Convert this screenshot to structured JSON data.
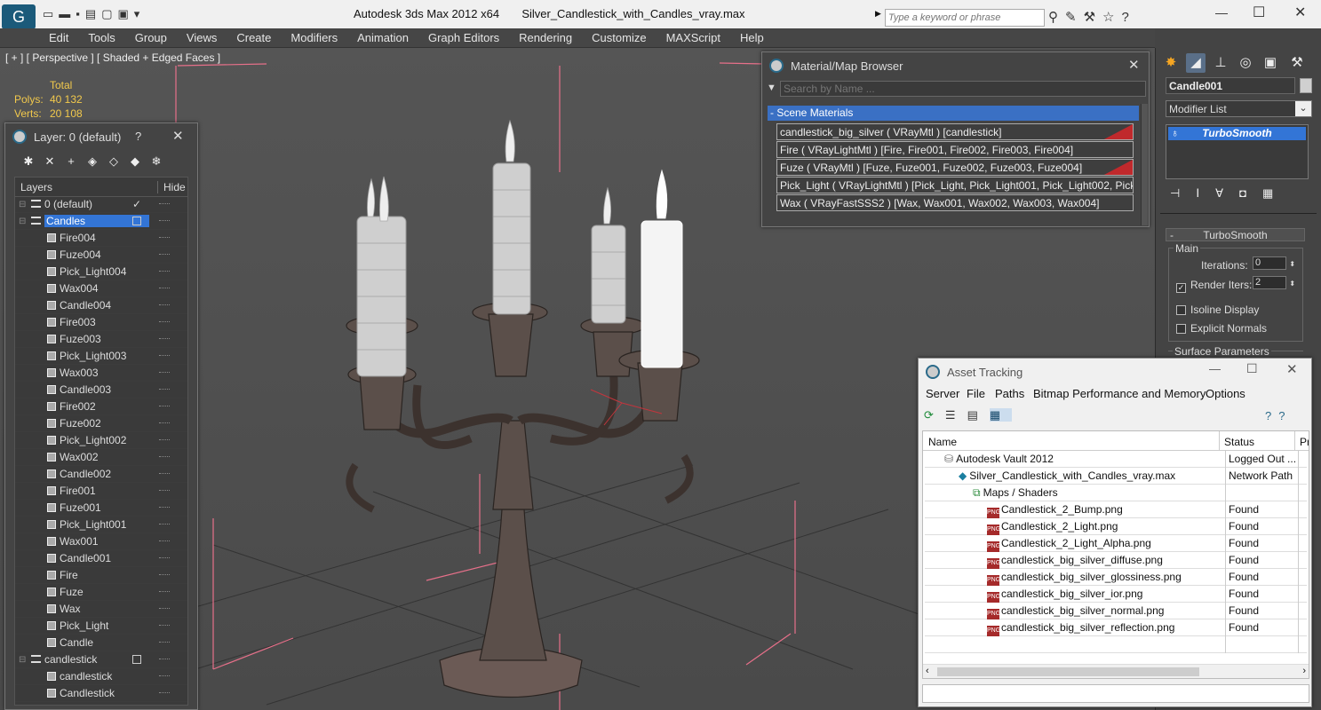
{
  "app": {
    "title": "Autodesk 3ds Max  2012 x64",
    "file": "Silver_Candlestick_with_Candles_vray.max",
    "search_placeholder": "Type a keyword or phrase"
  },
  "menu": [
    "Edit",
    "Tools",
    "Group",
    "Views",
    "Create",
    "Modifiers",
    "Animation",
    "Graph Editors",
    "Rendering",
    "Customize",
    "MAXScript",
    "Help"
  ],
  "viewport": {
    "label": "[ + ] [ Perspective ] [ Shaded + Edged Faces ]",
    "stats_header": "Total",
    "polys_label": "Polys:",
    "polys_value": "40 132",
    "verts_label": "Verts:",
    "verts_value": "20 108"
  },
  "layer_window": {
    "title": "Layer: 0 (default)",
    "help": "?",
    "col_layers": "Layers",
    "col_hide": "Hide",
    "rows": [
      {
        "label": "0 (default)",
        "type": "layer",
        "indent": 0,
        "selected": false
      },
      {
        "label": "Candles",
        "type": "layer",
        "indent": 0,
        "selected": true
      },
      {
        "label": "Fire004",
        "type": "obj",
        "indent": 1,
        "selected": false
      },
      {
        "label": "Fuze004",
        "type": "obj",
        "indent": 1,
        "selected": false
      },
      {
        "label": "Pick_Light004",
        "type": "obj",
        "indent": 1,
        "selected": false
      },
      {
        "label": "Wax004",
        "type": "obj",
        "indent": 1,
        "selected": false
      },
      {
        "label": "Candle004",
        "type": "obj",
        "indent": 1,
        "selected": false
      },
      {
        "label": "Fire003",
        "type": "obj",
        "indent": 1,
        "selected": false
      },
      {
        "label": "Fuze003",
        "type": "obj",
        "indent": 1,
        "selected": false
      },
      {
        "label": "Pick_Light003",
        "type": "obj",
        "indent": 1,
        "selected": false
      },
      {
        "label": "Wax003",
        "type": "obj",
        "indent": 1,
        "selected": false
      },
      {
        "label": "Candle003",
        "type": "obj",
        "indent": 1,
        "selected": false
      },
      {
        "label": "Fire002",
        "type": "obj",
        "indent": 1,
        "selected": false
      },
      {
        "label": "Fuze002",
        "type": "obj",
        "indent": 1,
        "selected": false
      },
      {
        "label": "Pick_Light002",
        "type": "obj",
        "indent": 1,
        "selected": false
      },
      {
        "label": "Wax002",
        "type": "obj",
        "indent": 1,
        "selected": false
      },
      {
        "label": "Candle002",
        "type": "obj",
        "indent": 1,
        "selected": false
      },
      {
        "label": "Fire001",
        "type": "obj",
        "indent": 1,
        "selected": false
      },
      {
        "label": "Fuze001",
        "type": "obj",
        "indent": 1,
        "selected": false
      },
      {
        "label": "Pick_Light001",
        "type": "obj",
        "indent": 1,
        "selected": false
      },
      {
        "label": "Wax001",
        "type": "obj",
        "indent": 1,
        "selected": false
      },
      {
        "label": "Candle001",
        "type": "obj",
        "indent": 1,
        "selected": false
      },
      {
        "label": "Fire",
        "type": "obj",
        "indent": 1,
        "selected": false
      },
      {
        "label": "Fuze",
        "type": "obj",
        "indent": 1,
        "selected": false
      },
      {
        "label": "Wax",
        "type": "obj",
        "indent": 1,
        "selected": false
      },
      {
        "label": "Pick_Light",
        "type": "obj",
        "indent": 1,
        "selected": false
      },
      {
        "label": "Candle",
        "type": "obj",
        "indent": 1,
        "selected": false
      },
      {
        "label": "candlestick",
        "type": "layer",
        "indent": 0,
        "selected": false
      },
      {
        "label": "candlestick",
        "type": "obj",
        "indent": 1,
        "selected": false
      },
      {
        "label": "Candlestick",
        "type": "obj",
        "indent": 1,
        "selected": false
      }
    ]
  },
  "material_browser": {
    "title": "Material/Map Browser",
    "search_placeholder": "Search by Name ...",
    "section": "- Scene Materials",
    "items": [
      {
        "label": "candlestick_big_silver  ( VRayMtl ) [candlestick]",
        "tag": true
      },
      {
        "label": "Fire  ( VRayLightMtl ) [Fire, Fire001, Fire002, Fire003, Fire004]",
        "tag": false
      },
      {
        "label": "Fuze  ( VRayMtl ) [Fuze, Fuze001, Fuze002, Fuze003, Fuze004]",
        "tag": true
      },
      {
        "label": "Pick_Light  ( VRayLightMtl ) [Pick_Light, Pick_Light001, Pick_Light002, Pick_...",
        "tag": false
      },
      {
        "label": "Wax  ( VRayFastSSS2 ) [Wax, Wax001, Wax002, Wax003, Wax004]",
        "tag": false
      }
    ]
  },
  "asset_tracking": {
    "title": "Asset Tracking",
    "menu": [
      "Server",
      "File",
      "Paths",
      "Bitmap Performance and Memory",
      "Options"
    ],
    "col_name": "Name",
    "col_status": "Status",
    "col_extra": "Pr",
    "rows": [
      {
        "name": "Autodesk Vault 2012",
        "status": "Logged Out ...",
        "indent": 0,
        "icon": "vault"
      },
      {
        "name": "Silver_Candlestick_with_Candles_vray.max",
        "status": "Network Path",
        "indent": 1,
        "icon": "max"
      },
      {
        "name": "Maps / Shaders",
        "status": "",
        "indent": 2,
        "icon": "maps"
      },
      {
        "name": "Candlestick_2_Bump.png",
        "status": "Found",
        "indent": 3,
        "icon": "png"
      },
      {
        "name": "Candlestick_2_Light.png",
        "status": "Found",
        "indent": 3,
        "icon": "png"
      },
      {
        "name": "Candlestick_2_Light_Alpha.png",
        "status": "Found",
        "indent": 3,
        "icon": "png"
      },
      {
        "name": "candlestick_big_silver_diffuse.png",
        "status": "Found",
        "indent": 3,
        "icon": "png"
      },
      {
        "name": "candlestick_big_silver_glossiness.png",
        "status": "Found",
        "indent": 3,
        "icon": "png"
      },
      {
        "name": "candlestick_big_silver_ior.png",
        "status": "Found",
        "indent": 3,
        "icon": "png"
      },
      {
        "name": "candlestick_big_silver_normal.png",
        "status": "Found",
        "indent": 3,
        "icon": "png"
      },
      {
        "name": "candlestick_big_silver_reflection.png",
        "status": "Found",
        "indent": 3,
        "icon": "png"
      }
    ]
  },
  "command_panel": {
    "object_name": "Candle001",
    "modifier_list": "Modifier List",
    "stack_item": "TurboSmooth",
    "rollout_title": "TurboSmooth",
    "group_main": "Main",
    "iterations_label": "Iterations:",
    "iterations_value": "0",
    "render_iters_label": "Render Iters:",
    "render_iters_value": "2",
    "render_iters_checked": true,
    "isoline_label": "Isoline Display",
    "explicit_normals_label": "Explicit Normals",
    "surface_params": "Surface Parameters"
  },
  "colors": {
    "selection": "#3375d6",
    "material_tag": "#c0292c",
    "viewport_bg": "#4d4d4d",
    "panel_bg": "#444444"
  }
}
